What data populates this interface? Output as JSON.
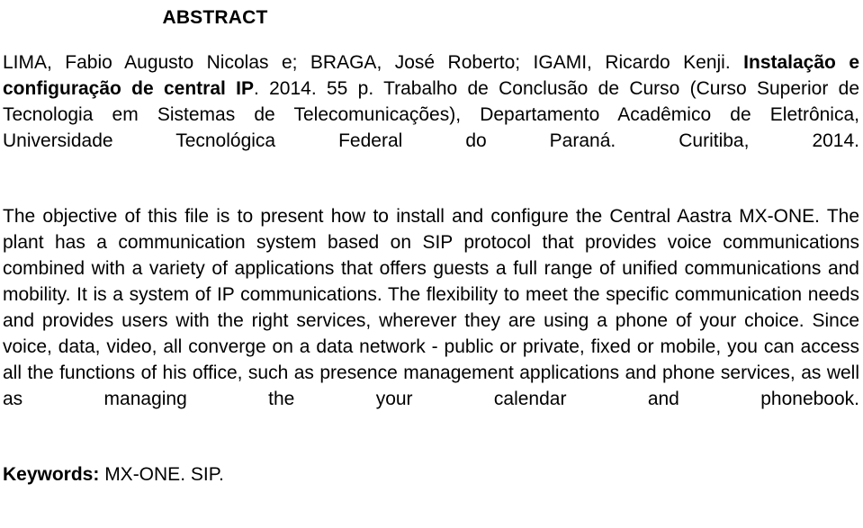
{
  "document": {
    "title": "ABSTRACT",
    "reference": {
      "authors": "LIMA, Fabio Augusto Nicolas e; BRAGA, José Roberto; IGAMI, Ricardo Kenji.",
      "work_title": "Instalação e configuração de central IP",
      "publication_details": ". 2014. 55 p. Trabalho de Conclusão de Curso (Curso Superior de Tecnologia em Sistemas de Telecomunicações), Departamento Acadêmico de Eletrônica, Universidade Tecnológica Federal do Paraná. Curitiba, 2014."
    },
    "abstract_body": "The objective of this file is to present how to install and configure the Central Aastra MX-ONE. The plant has a communication system based on SIP protocol that provides voice communications combined with a variety of applications that offers guests a full range of unified communications and mobility. It is a system of IP communications. The flexibility to meet the specific communication needs and provides users with the right services, wherever they are using a phone of your choice. Since voice, data, video, all converge on a data network - public or private, fixed or mobile, you can access all the functions of his office, such as presence management applications and phone services, as well as managing the your calendar and phonebook.",
    "keywords": {
      "label": "Keywords:",
      "values": " MX-ONE. SIP."
    }
  },
  "colors": {
    "background": "#ffffff",
    "text": "#000000"
  }
}
